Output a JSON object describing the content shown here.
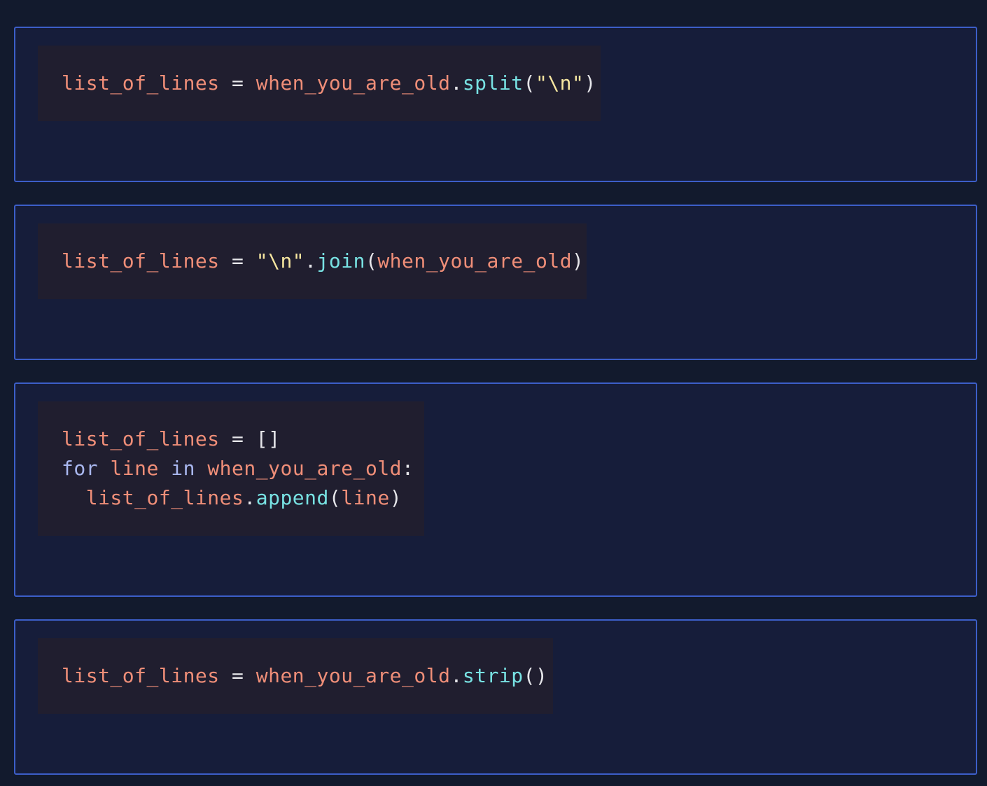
{
  "colors": {
    "page_background": "#121a2d",
    "card_background": "#161d3a",
    "card_border": "#3c5ec8",
    "code_background": "#201e2f",
    "variable": "#ef8e78",
    "method": "#78e2e3",
    "string": "#f6e6a0",
    "keyword": "#a9b7ef",
    "plain": "#e6e6ea"
  },
  "options": [
    {
      "lines": [
        {
          "tokens": [
            {
              "type": "var",
              "text": "list_of_lines"
            },
            {
              "type": "op",
              "text": " = "
            },
            {
              "type": "var",
              "text": "when_you_are_old"
            },
            {
              "type": "punc",
              "text": "."
            },
            {
              "type": "method",
              "text": "split"
            },
            {
              "type": "punc",
              "text": "("
            },
            {
              "type": "str",
              "text": "\"\\n\""
            },
            {
              "type": "punc",
              "text": ")"
            }
          ]
        }
      ]
    },
    {
      "lines": [
        {
          "tokens": [
            {
              "type": "var",
              "text": "list_of_lines"
            },
            {
              "type": "op",
              "text": " = "
            },
            {
              "type": "str",
              "text": "\"\\n\""
            },
            {
              "type": "punc",
              "text": "."
            },
            {
              "type": "method",
              "text": "join"
            },
            {
              "type": "punc",
              "text": "("
            },
            {
              "type": "var",
              "text": "when_you_are_old"
            },
            {
              "type": "punc",
              "text": ")"
            }
          ]
        }
      ]
    },
    {
      "lines": [
        {
          "tokens": [
            {
              "type": "var",
              "text": "list_of_lines"
            },
            {
              "type": "op",
              "text": " = "
            },
            {
              "type": "punc",
              "text": "[]"
            }
          ]
        },
        {
          "tokens": [
            {
              "type": "kw",
              "text": "for"
            },
            {
              "type": "op",
              "text": " "
            },
            {
              "type": "var",
              "text": "line"
            },
            {
              "type": "op",
              "text": " "
            },
            {
              "type": "kw",
              "text": "in"
            },
            {
              "type": "op",
              "text": " "
            },
            {
              "type": "var",
              "text": "when_you_are_old"
            },
            {
              "type": "punc",
              "text": ":"
            }
          ]
        },
        {
          "tokens": [
            {
              "type": "op",
              "text": "  "
            },
            {
              "type": "var",
              "text": "list_of_lines"
            },
            {
              "type": "punc",
              "text": "."
            },
            {
              "type": "method",
              "text": "append"
            },
            {
              "type": "punc",
              "text": "("
            },
            {
              "type": "var",
              "text": "line"
            },
            {
              "type": "punc",
              "text": ")"
            }
          ]
        }
      ]
    },
    {
      "lines": [
        {
          "tokens": [
            {
              "type": "var",
              "text": "list_of_lines"
            },
            {
              "type": "op",
              "text": " = "
            },
            {
              "type": "var",
              "text": "when_you_are_old"
            },
            {
              "type": "punc",
              "text": "."
            },
            {
              "type": "method",
              "text": "strip"
            },
            {
              "type": "punc",
              "text": "()"
            }
          ]
        }
      ]
    }
  ]
}
